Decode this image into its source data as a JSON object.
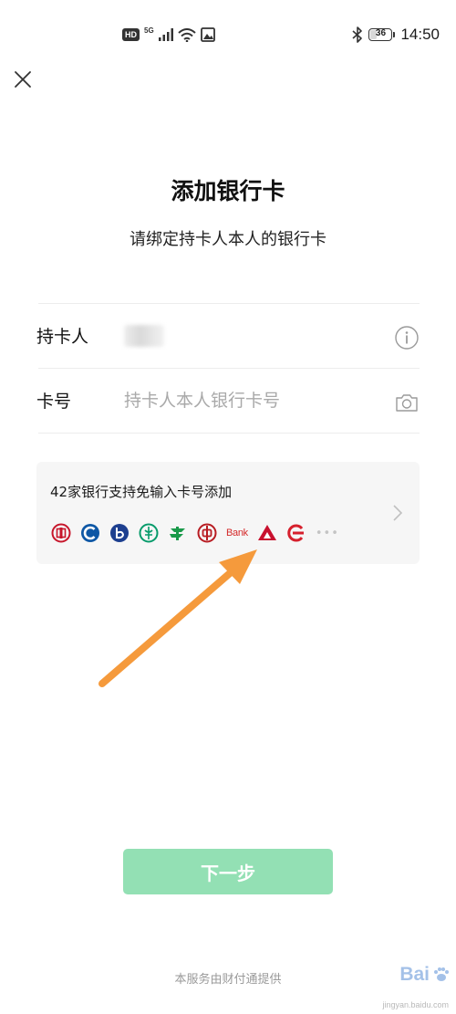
{
  "status_bar": {
    "hd_badge": "HD",
    "network": "5G",
    "battery_level": "36",
    "battery_fraction": 0.36,
    "time": "14:50",
    "icons": [
      "hd-icon",
      "signal-icon",
      "wifi-icon",
      "image-icon",
      "bluetooth-icon",
      "battery-icon"
    ]
  },
  "header": {
    "close_icon": "close-icon",
    "title": "添加银行卡",
    "subtitle": "请绑定持卡人本人的银行卡"
  },
  "form": {
    "holder_label": "持卡人",
    "holder_info_icon": "info-icon",
    "card_label": "卡号",
    "card_value": "",
    "card_placeholder": "持卡人本人银行卡号",
    "card_camera_icon": "camera-icon"
  },
  "bank_panel": {
    "text": "42家银行支持免输入卡号添加",
    "bank_text_logo": "Bank",
    "more": "•••",
    "chevron_icon": "chevron-right-icon"
  },
  "colors": {
    "accent_green": "#93e0b4",
    "annotation_arrow": "#f59a3c",
    "panel_bg": "#f6f6f6"
  },
  "next_button": {
    "label": "下一步"
  },
  "footer": {
    "text": "本服务由财付通提供"
  },
  "watermark": {
    "brand": "Bai",
    "sub": "jingyan.baidu.com"
  }
}
